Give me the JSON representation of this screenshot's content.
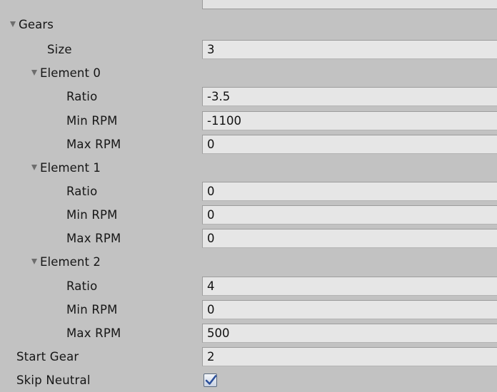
{
  "gears": {
    "label": "Gears",
    "size": {
      "label": "Size",
      "value": "3"
    },
    "elements": [
      {
        "label": "Element 0",
        "ratio": {
          "label": "Ratio",
          "value": "-3.5"
        },
        "min_rpm": {
          "label": "Min RPM",
          "value": "-1100"
        },
        "max_rpm": {
          "label": "Max RPM",
          "value": "0"
        }
      },
      {
        "label": "Element 1",
        "ratio": {
          "label": "Ratio",
          "value": "0"
        },
        "min_rpm": {
          "label": "Min RPM",
          "value": "0"
        },
        "max_rpm": {
          "label": "Max RPM",
          "value": "0"
        }
      },
      {
        "label": "Element 2",
        "ratio": {
          "label": "Ratio",
          "value": "4"
        },
        "min_rpm": {
          "label": "Min RPM",
          "value": "0"
        },
        "max_rpm": {
          "label": "Max RPM",
          "value": "500"
        }
      }
    ]
  },
  "start_gear": {
    "label": "Start Gear",
    "value": "2"
  },
  "skip_neutral": {
    "label": "Skip Neutral",
    "checked": true
  },
  "icons": {
    "foldout": "triangle-down-icon",
    "check": "checkmark-icon"
  },
  "colors": {
    "panel_bg": "#c2c2c2",
    "field_bg": "#e6e6e6",
    "field_border": "#9c9c9c",
    "check_color": "#2b4f9a"
  }
}
